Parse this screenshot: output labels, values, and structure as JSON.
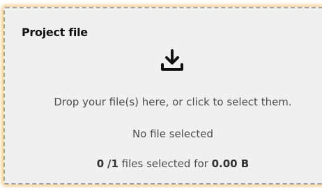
{
  "dropzone": {
    "title": "Project file",
    "icon": "download-icon",
    "instruction": "Drop your file(s) here, or click to select them.",
    "status": "No file selected",
    "selected_count": "0",
    "separator": "/",
    "max_count": "1",
    "count_text": "files selected for",
    "total_size": "0.00 B"
  },
  "colors": {
    "background": "#f0f0f0",
    "border": "#a3a3a3",
    "glow": "#f6c882",
    "text": "#4d4d4d",
    "title": "#111111"
  }
}
